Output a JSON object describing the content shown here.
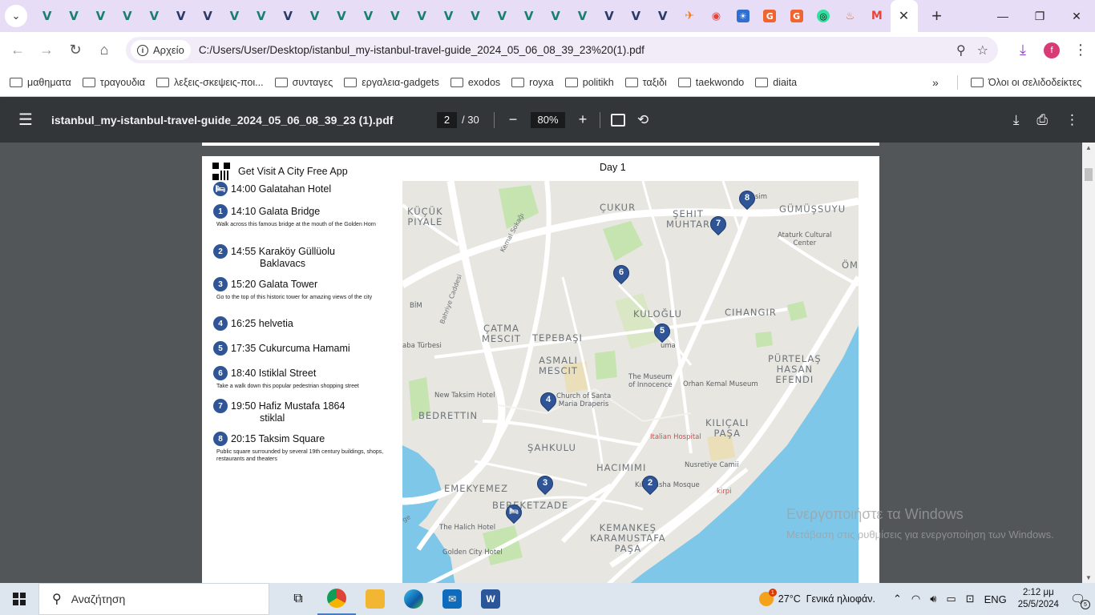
{
  "browser": {
    "tabs": [
      {
        "icon": "v-logo-icon",
        "glyph": "V",
        "style": "green"
      },
      {
        "icon": "v-logo-icon",
        "glyph": "V",
        "style": "green"
      },
      {
        "icon": "v-logo-icon",
        "glyph": "V",
        "style": "green"
      },
      {
        "icon": "v-logo-icon",
        "glyph": "V",
        "style": "green"
      },
      {
        "icon": "v-logo-icon",
        "glyph": "V",
        "style": "green"
      },
      {
        "icon": "v-logo-icon",
        "glyph": "V",
        "style": "navy"
      },
      {
        "icon": "v-logo-icon",
        "glyph": "V",
        "style": "navy"
      },
      {
        "icon": "v-logo-icon",
        "glyph": "V",
        "style": "green"
      },
      {
        "icon": "v-logo-icon",
        "glyph": "V",
        "style": "green"
      },
      {
        "icon": "v-logo-icon",
        "glyph": "V",
        "style": "navy"
      },
      {
        "icon": "v-logo-icon",
        "glyph": "V",
        "style": "green"
      },
      {
        "icon": "v-logo-icon",
        "glyph": "V",
        "style": "green"
      },
      {
        "icon": "v-logo-icon",
        "glyph": "V",
        "style": "green"
      },
      {
        "icon": "v-logo-icon",
        "glyph": "V",
        "style": "green"
      },
      {
        "icon": "v-logo-icon",
        "glyph": "V",
        "style": "green"
      },
      {
        "icon": "v-logo-icon",
        "glyph": "V",
        "style": "green"
      },
      {
        "icon": "v-logo-icon",
        "glyph": "V",
        "style": "green"
      },
      {
        "icon": "v-logo-icon",
        "glyph": "V",
        "style": "green"
      },
      {
        "icon": "v-logo-icon",
        "glyph": "V",
        "style": "green"
      },
      {
        "icon": "v-logo-icon",
        "glyph": "V",
        "style": "green"
      },
      {
        "icon": "v-logo-icon",
        "glyph": "V",
        "style": "green"
      },
      {
        "icon": "v-logo-icon",
        "glyph": "V",
        "style": "navy"
      },
      {
        "icon": "v-logo-icon",
        "glyph": "V",
        "style": "navy"
      },
      {
        "icon": "v-logo-icon",
        "glyph": "V",
        "style": "navy"
      },
      {
        "icon": "airplane-icon",
        "glyph": "✈",
        "style": "orange"
      },
      {
        "icon": "maps-pin-icon",
        "glyph": "◉",
        "style": "maps"
      },
      {
        "icon": "sunset-icon",
        "glyph": "☀",
        "style": "bluebox"
      },
      {
        "icon": "g-logo-icon",
        "glyph": "G",
        "style": "orangebox"
      },
      {
        "icon": "g-logo-icon",
        "glyph": "G",
        "style": "orangebox"
      },
      {
        "icon": "tripadvisor-icon",
        "glyph": "◎",
        "style": "tripadvisor"
      },
      {
        "icon": "lotus-icon",
        "glyph": "♨",
        "style": "lotus"
      },
      {
        "icon": "gmail-icon",
        "glyph": "M",
        "style": "gmail"
      }
    ],
    "active_tab_close": "✕",
    "new_tab": "+",
    "nav": {
      "back": "←",
      "forward": "→",
      "reload": "↻",
      "home": "⌂"
    },
    "address": {
      "chip_label": "Αρχείο",
      "url": "C:/Users/User/Desktop/istanbul_my-istanbul-travel-guide_2024_05_06_08_39_23%20(1).pdf"
    },
    "profile_initial": "f",
    "bookmarks": [
      "μαθηματα",
      "τραγουδια",
      "λεξεις-σκεψεις-ποι...",
      "συνταγες",
      "εργαλεια-gadgets",
      "exodos",
      "royxa",
      "politikh",
      "ταξιδι",
      "taekwondo",
      "diaita"
    ],
    "bookmarks_overflow": "»",
    "all_bookmarks": "Όλοι οι σελιδοδείκτες"
  },
  "pdf": {
    "filename": "istanbul_my-istanbul-travel-guide_2024_05_06_08_39_23 (1).pdf",
    "current_page": "2",
    "total_pages": "/ 30",
    "zoom": "80%"
  },
  "guide": {
    "app_text": "Get Visit A City Free App",
    "day_title": "Day 1",
    "stops": [
      {
        "badge": "🛏",
        "time_name": "14:00 Galatahan Hotel",
        "name_line2": "",
        "desc": ""
      },
      {
        "badge": "1",
        "time_name": "14:10 Galata Bridge",
        "name_line2": "",
        "desc": "Walk across this famous bridge at the mouth of the Golden Horn"
      },
      {
        "badge": "2",
        "time_name": "14:55 Karaköy Güllüolu",
        "name_line2": "Baklavacs",
        "desc": ""
      },
      {
        "badge": "3",
        "time_name": "15:20 Galata Tower",
        "name_line2": "",
        "desc": "Go to the top of this historic tower for amazing views of the city"
      },
      {
        "badge": "4",
        "time_name": "16:25 helvetia",
        "name_line2": "",
        "desc": ""
      },
      {
        "badge": "5",
        "time_name": "17:35 Cukurcuma Hamami",
        "name_line2": "",
        "desc": ""
      },
      {
        "badge": "6",
        "time_name": "18:40 Istiklal Street",
        "name_line2": "",
        "desc": "Take a walk down this popular pedestrian shopping street"
      },
      {
        "badge": "7",
        "time_name": "19:50 Hafiz Mustafa 1864",
        "name_line2": "stiklal",
        "desc": ""
      },
      {
        "badge": "8",
        "time_name": "20:15 Taksim Square",
        "name_line2": "",
        "desc": "Public square surrounded by several 19th century buildings, shops, restaurants and theaters"
      }
    ]
  },
  "map": {
    "districts": [
      "KÜÇÜK\nPIYALE",
      "ÇUKUR",
      "ŞEHIT\nMUHTAR",
      "GÜMÜŞSUYU",
      "ÇATMA\nMESCIT",
      "TEPEBAŞI",
      "KULOĞLU",
      "CIHANGIR",
      "ASMALI\nMESCIT",
      "PÜRTELAŞ\nHASAN\nEFENDI",
      "BEDRETTIN",
      "ŞAHKULU",
      "KILIÇALI\nPAŞA",
      "HACIMIMI",
      "EMEKYEMEZ",
      "BEREKETZADE",
      "KEMANKEŞ\nKARAMUSTAFA\nPAŞA",
      "ÖM"
    ],
    "pois": [
      "Ataturk Cultural\nCenter",
      "BİM",
      "aba Türbesi",
      "The Museum\nof Innocence",
      "Orhan Kemal Museum",
      "New Taksim Hotel",
      "Church of Santa\nMaria Draperis",
      "Italian Hospital",
      "Nusretiye Camii",
      "Kılıç Pasha Mosque",
      "kirpi",
      "The Halich Hotel",
      "Golden City Hotel",
      "uma",
      "sim"
    ],
    "streets": [
      "Kemal Sokağı",
      "Bahriye Caddesi",
      "ge"
    ],
    "pins": [
      "8",
      "7",
      "6",
      "5",
      "4",
      "3",
      "2",
      "🛏"
    ]
  },
  "watermark": {
    "line1": "Ενεργοποιήστε τα Windows",
    "line2": "Μετάβαση στις ρυθμίσεις για ενεργοποίηση των Windows."
  },
  "taskbar": {
    "search_placeholder": "Αναζήτηση",
    "weather": "27°C  Γενικά ηλιοφάν.",
    "weather_badge": "1",
    "lang": "ENG",
    "time": "2:12 μμ",
    "date": "25/5/2024",
    "notif_count": "5"
  },
  "colors": {
    "accent": "#2f5597",
    "tabstrip": "#e8ddf6",
    "water": "#7fc7e8",
    "park": "#c5e4b0"
  }
}
